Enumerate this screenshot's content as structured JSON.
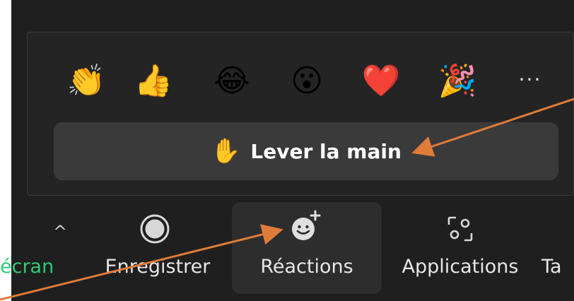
{
  "reactions": {
    "emojis": [
      {
        "name": "clap",
        "glyph": "👏"
      },
      {
        "name": "thumbs-up",
        "glyph": "👍"
      },
      {
        "name": "tears-of-joy",
        "glyph": "😂"
      },
      {
        "name": "open-mouth",
        "glyph": "😮"
      },
      {
        "name": "heart",
        "glyph": "❤️"
      },
      {
        "name": "party-popper",
        "glyph": "🎉"
      }
    ],
    "more_label": "···",
    "raise_hand_icon": "✋",
    "raise_hand_label": "Lever la main"
  },
  "toolbar": {
    "collapse_icon": "^",
    "share_screen_partial": "écran",
    "record_label": "Enregistrer",
    "reactions_label": "Réactions",
    "apps_label": "Applications",
    "next_partial": "Ta"
  },
  "colors": {
    "background": "#1f1f1f",
    "popup": "#242424",
    "button": "#3a3a3a",
    "selected": "#2d2d2d",
    "annotation_arrow": "#e07b39",
    "share_text": "#2ecc71"
  }
}
